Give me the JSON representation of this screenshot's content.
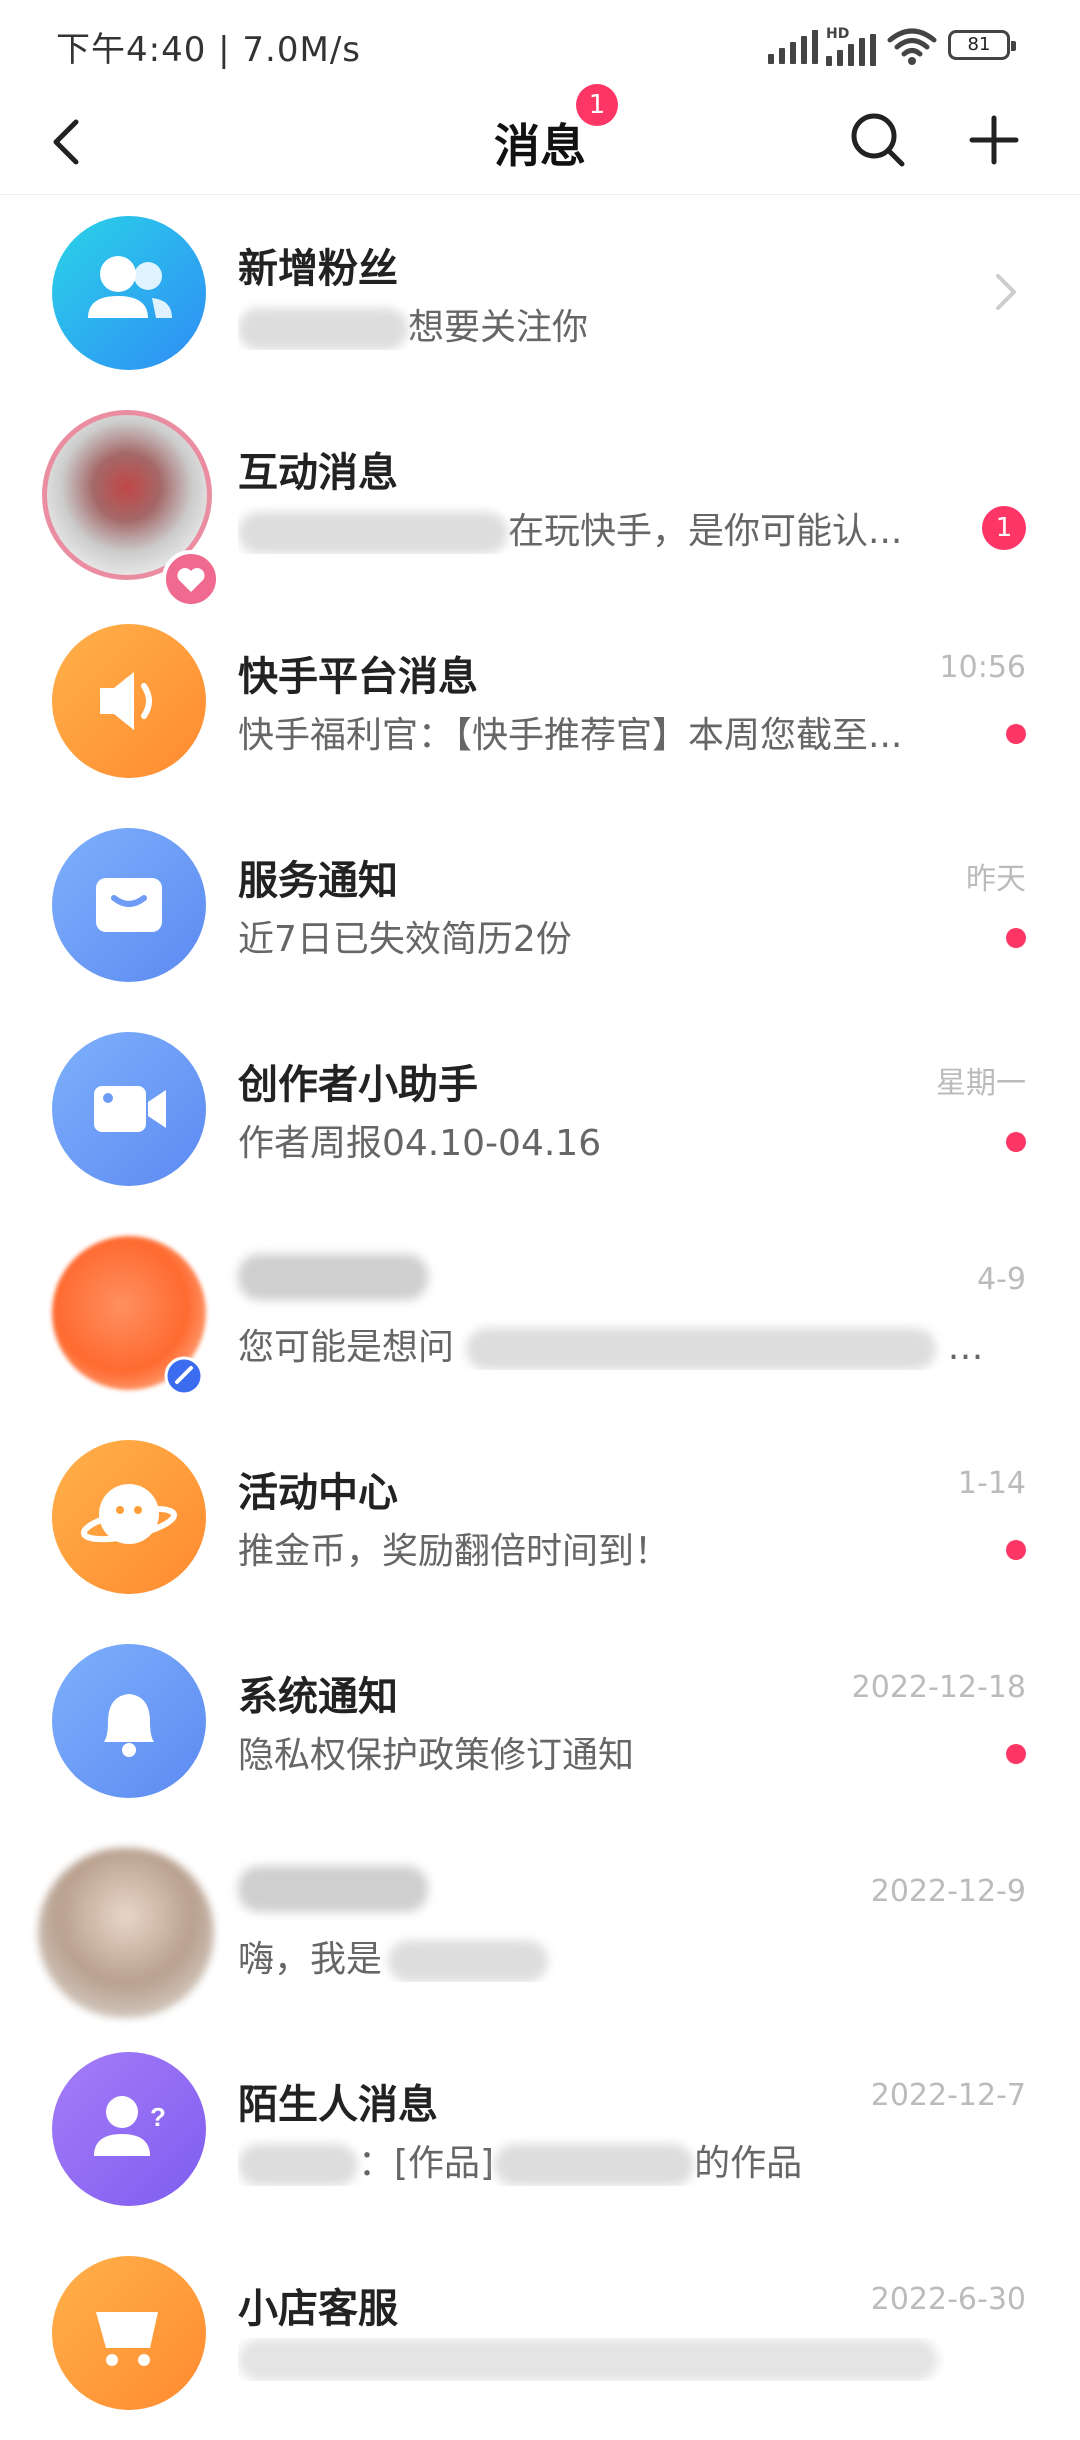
{
  "status_bar": {
    "time": "下午4:40 | 7.0M/s",
    "hd": "HD",
    "battery": "81"
  },
  "nav": {
    "title": "消息",
    "badge": "1"
  },
  "rows": [
    {
      "name": "新增粉丝",
      "sub": "想要关注你",
      "time": "",
      "indicator": "chevron",
      "avatar_icon": "fans-icon",
      "color": "#27b6f1"
    },
    {
      "name": "互动消息",
      "sub": "在玩快手，是你可能认...",
      "time": "",
      "indicator": "count",
      "count": "1",
      "avatar_icon": "user-photo",
      "color": "#e87a8e"
    },
    {
      "name": "快手平台消息",
      "sub": "快手福利官：【快手推荐官】本周您截至...",
      "time": "10:56",
      "indicator": "dot",
      "avatar_icon": "speaker-icon",
      "color": "#ff9d3a"
    },
    {
      "name": "服务通知",
      "sub": "近7日已失效简历2份",
      "time": "昨天",
      "indicator": "dot",
      "avatar_icon": "envelope-icon",
      "color": "#6e9bf5"
    },
    {
      "name": "创作者小助手",
      "sub": "作者周报04.10-04.16",
      "time": "星期一",
      "indicator": "dot",
      "avatar_icon": "video-camera-icon",
      "color": "#6e9bf5"
    },
    {
      "name": "",
      "sub": "您可能是想问",
      "time": "4-9",
      "indicator": "none",
      "avatar_icon": "user-photo",
      "color": "#ff7a3d"
    },
    {
      "name": "活动中心",
      "sub": "推金币，奖励翻倍时间到！",
      "time": "1-14",
      "indicator": "dot",
      "avatar_icon": "planet-icon",
      "color": "#ff9d3a"
    },
    {
      "name": "系统通知",
      "sub": "隐私权保护政策修订通知",
      "time": "2022-12-18",
      "indicator": "dot",
      "avatar_icon": "bell-icon",
      "color": "#6e9bf5"
    },
    {
      "name": "",
      "sub": "嗨，我是",
      "time": "2022-12-9",
      "indicator": "none",
      "avatar_icon": "user-photo",
      "color": "#b9a99a"
    },
    {
      "name": "陌生人消息",
      "sub": "：[作品]",
      "sub2": "的作品",
      "time": "2022-12-7",
      "indicator": "none",
      "avatar_icon": "stranger-icon",
      "color": "#9b6ef5"
    },
    {
      "name": "小店客服",
      "sub": "",
      "time": "2022-6-30",
      "indicator": "none",
      "avatar_icon": "cart-icon",
      "color": "#ff9d3a"
    }
  ]
}
